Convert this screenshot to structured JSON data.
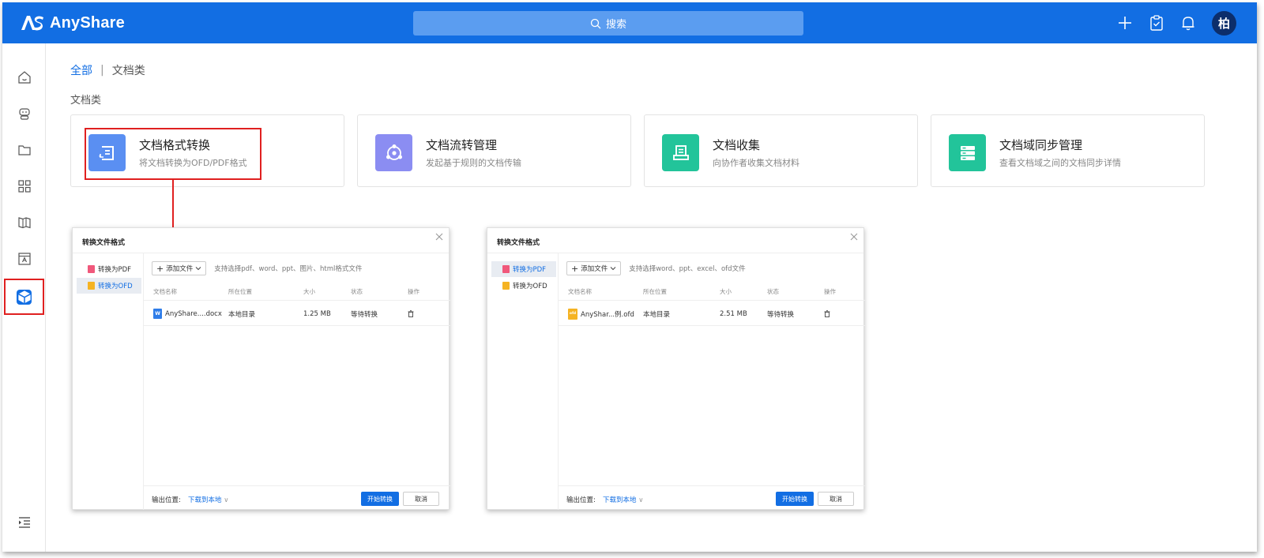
{
  "app": {
    "name": "AnyShare"
  },
  "search": {
    "label": "搜索"
  },
  "user": {
    "avatar_text": "柏"
  },
  "breadcrumb": {
    "root": "全部",
    "separator": "|",
    "current": "文档类"
  },
  "section": {
    "title": "文档类"
  },
  "cards": [
    {
      "title": "文档格式转换",
      "desc": "将文档转换为OFD/PDF格式",
      "icon": "format-convert-icon",
      "color": "#5a8ff2"
    },
    {
      "title": "文档流转管理",
      "desc": "发起基于规则的文档传输",
      "icon": "flow-icon",
      "color": "#8b8df2"
    },
    {
      "title": "文档收集",
      "desc": "向协作者收集文档材料",
      "icon": "collect-icon",
      "color": "#22c49a"
    },
    {
      "title": "文档域同步管理",
      "desc": "查看文档域之间的文档同步详情",
      "icon": "sync-icon",
      "color": "#22c49a"
    }
  ],
  "dialogs": [
    {
      "title": "转换文件格式",
      "tabs": [
        {
          "label": "转换为PDF",
          "icon_color": "#f0587b"
        },
        {
          "label": "转换为OFD",
          "icon_color": "#f5b323"
        }
      ],
      "selected_tab": 1,
      "add_label": "添加文件",
      "hint": "支持选择pdf、word、ppt、图片、html格式文件",
      "columns": [
        "文档名称",
        "所在位置",
        "大小",
        "状态",
        "操作"
      ],
      "row": {
        "name": "AnyShare....docx",
        "icon_label": "W",
        "icon_color": "#2f7de9",
        "location": "本地目录",
        "size": "1.25 MB",
        "status": "等待转换"
      },
      "output_label": "输出位置:",
      "output_value": "下载到本地",
      "start_label": "开始转换",
      "cancel_label": "取消"
    },
    {
      "title": "转换文件格式",
      "tabs": [
        {
          "label": "转换为PDF",
          "icon_color": "#f0587b"
        },
        {
          "label": "转换为OFD",
          "icon_color": "#f5b323"
        }
      ],
      "selected_tab": 0,
      "add_label": "添加文件",
      "hint": "支持选择word、ppt、excel、ofd文件",
      "columns": [
        "文档名称",
        "所在位置",
        "大小",
        "状态",
        "操作"
      ],
      "row": {
        "name": "AnyShar...例.ofd",
        "icon_label": "ofd",
        "icon_color": "#f5b323",
        "location": "本地目录",
        "size": "2.51 MB",
        "status": "等待转换"
      },
      "output_label": "输出位置:",
      "output_value": "下载到本地",
      "start_label": "开始转换",
      "cancel_label": "取消"
    }
  ],
  "colors": {
    "brand": "#126ee3",
    "highlight": "#e02020"
  }
}
